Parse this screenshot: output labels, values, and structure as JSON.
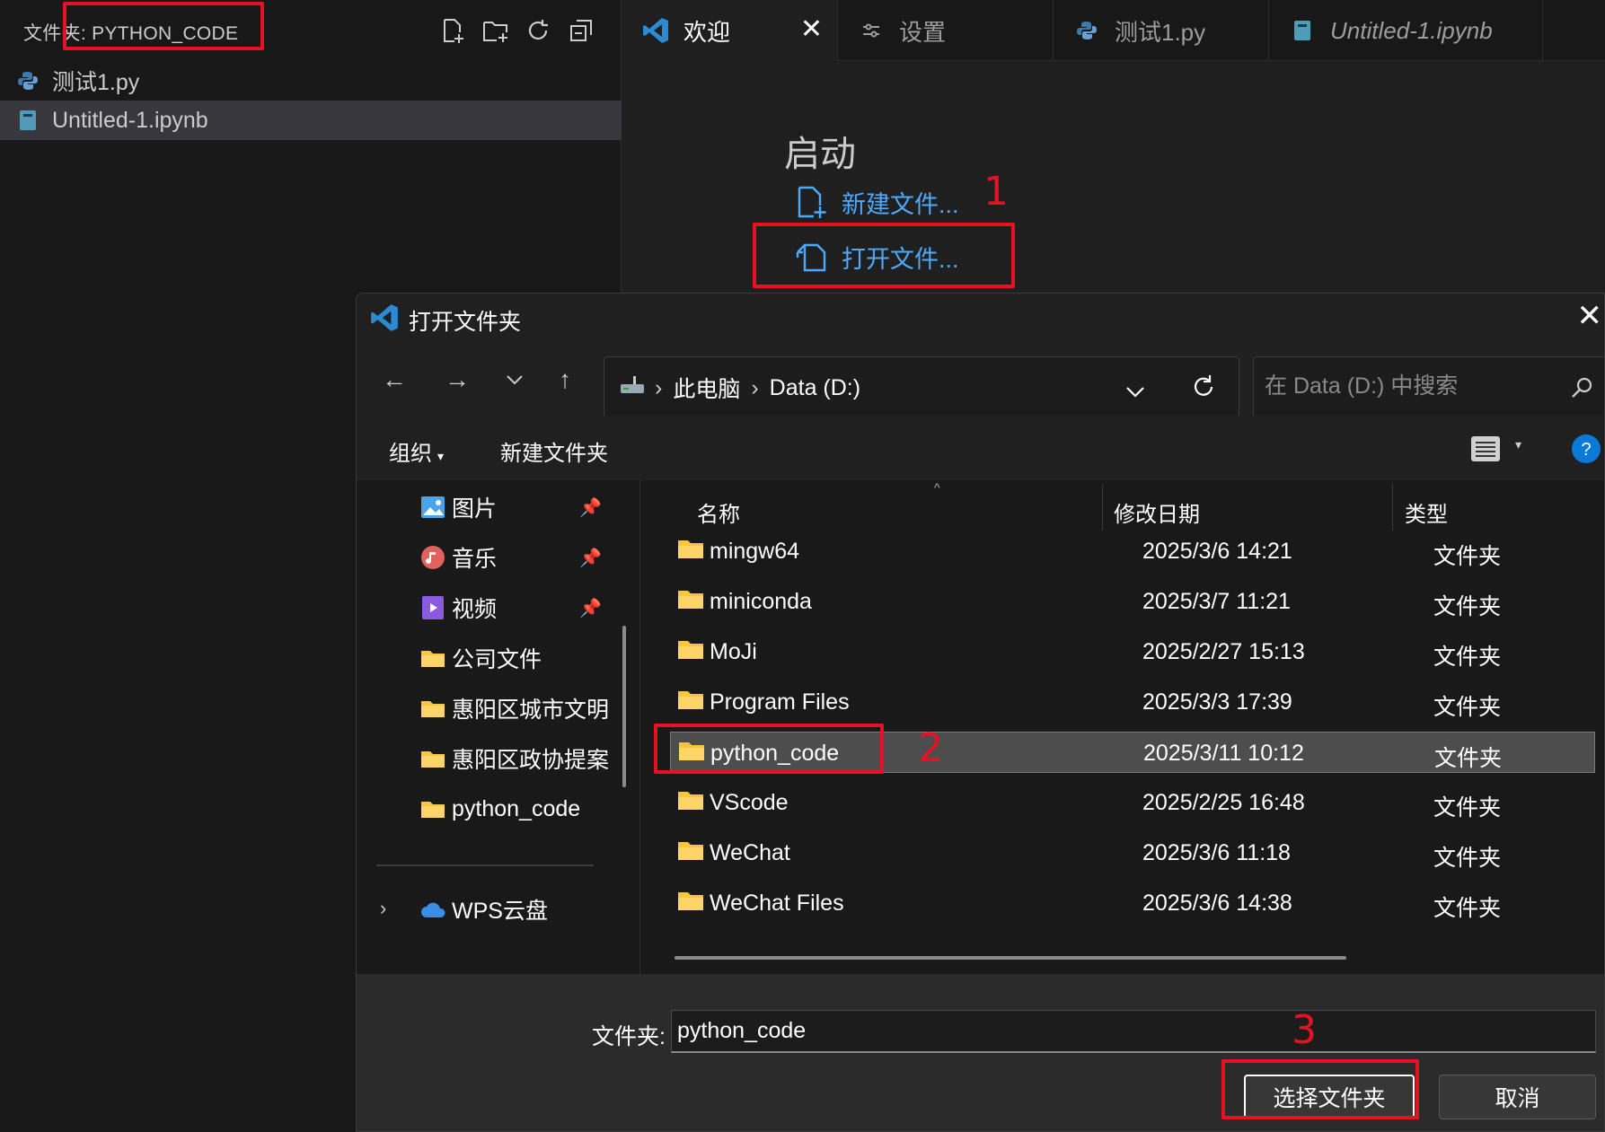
{
  "explorer": {
    "title": "文件夹: PYTHON_CODE",
    "files": [
      {
        "name": "测试1.py",
        "icon": "python-icon"
      },
      {
        "name": "Untitled-1.ipynb",
        "icon": "notebook-icon"
      }
    ]
  },
  "tabs": [
    {
      "label": "欢迎",
      "icon": "vscode-logo-icon",
      "active": true
    },
    {
      "label": "设置",
      "icon": "settings-sliders-icon"
    },
    {
      "label": "测试1.py",
      "icon": "python-icon"
    },
    {
      "label": "Untitled-1.ipynb",
      "icon": "notebook-icon"
    }
  ],
  "welcome": {
    "heading": "启动",
    "new_file": "新建文件...",
    "open_file": "打开文件..."
  },
  "dialog": {
    "title": "打开文件夹",
    "breadcrumb": [
      "此电脑",
      "Data (D:)"
    ],
    "search_placeholder": "在 Data (D:) 中搜索",
    "cmd_organize": "组织",
    "cmd_new_folder": "新建文件夹",
    "nav_items": [
      {
        "label": "图片",
        "icon": "pictures-icon",
        "pinned": true
      },
      {
        "label": "音乐",
        "icon": "music-icon",
        "pinned": true
      },
      {
        "label": "视频",
        "icon": "video-icon",
        "pinned": true
      },
      {
        "label": "公司文件",
        "icon": "folder-icon"
      },
      {
        "label": "惠阳区城市文明",
        "icon": "folder-icon"
      },
      {
        "label": "惠阳区政协提案",
        "icon": "folder-icon"
      },
      {
        "label": "python_code",
        "icon": "folder-icon"
      }
    ],
    "nav_cloud": "WPS云盘",
    "columns": {
      "name": "名称",
      "date": "修改日期",
      "type": "类型"
    },
    "rows": [
      {
        "name": "mingw64",
        "date": "2025/3/6 14:21",
        "type": "文件夹"
      },
      {
        "name": "miniconda",
        "date": "2025/3/7 11:21",
        "type": "文件夹"
      },
      {
        "name": "MoJi",
        "date": "2025/2/27 15:13",
        "type": "文件夹"
      },
      {
        "name": "Program Files",
        "date": "2025/3/3 17:39",
        "type": "文件夹"
      },
      {
        "name": "python_code",
        "date": "2025/3/11 10:12",
        "type": "文件夹",
        "selected": true
      },
      {
        "name": "VScode",
        "date": "2025/2/25 16:48",
        "type": "文件夹"
      },
      {
        "name": "WeChat",
        "date": "2025/3/6 11:18",
        "type": "文件夹"
      },
      {
        "name": "WeChat Files",
        "date": "2025/3/6 14:38",
        "type": "文件夹"
      }
    ],
    "folder_label": "文件夹:",
    "folder_value": "python_code",
    "select_button": "选择文件夹",
    "cancel_button": "取消"
  },
  "annotations": {
    "step1": "1",
    "step2": "2",
    "step3": "3"
  },
  "colors": {
    "annotation_red": "#e81123",
    "link_blue": "#4daafc",
    "vscode_blue": "#2a8ad4",
    "folder_yellow": "#f5c542"
  }
}
